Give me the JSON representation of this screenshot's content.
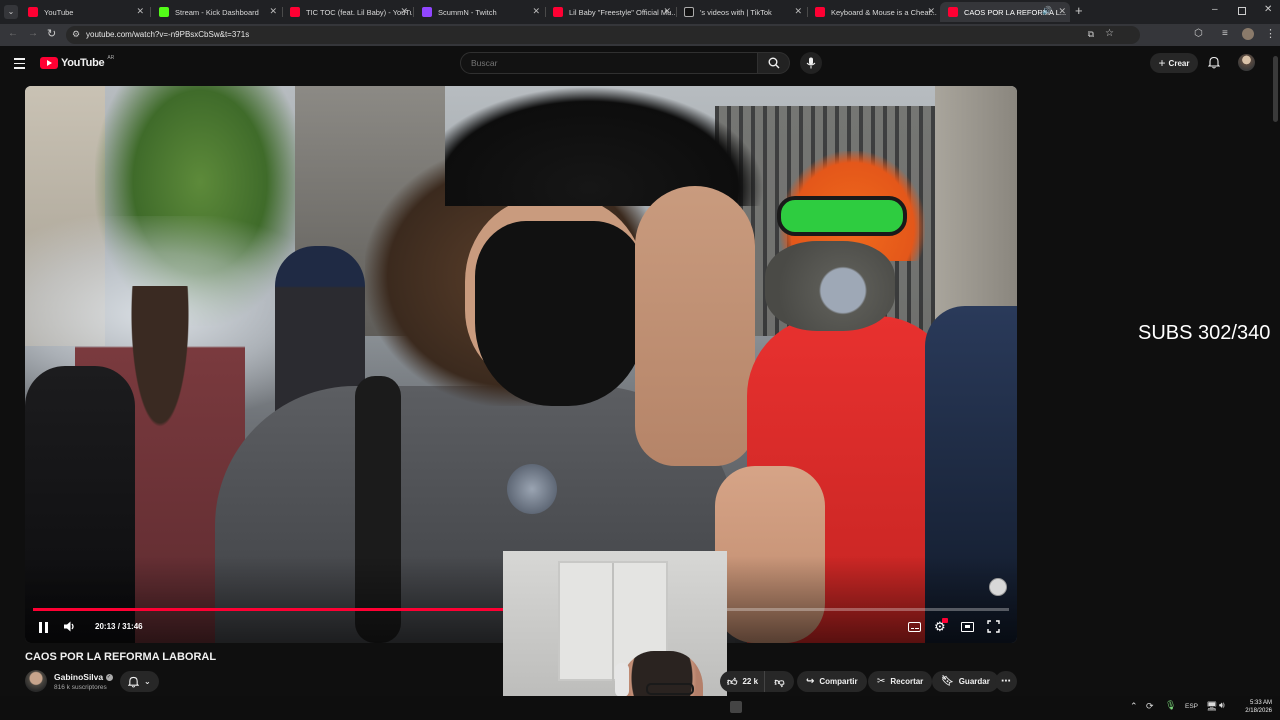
{
  "browser": {
    "tabs": [
      {
        "label": "YouTube",
        "color": "#ff0033"
      },
      {
        "label": "Stream - Kick Dashboard",
        "color": "#53fc18"
      },
      {
        "label": "TIC TOC (feat. Lil Baby) - YouTu...",
        "color": "#ff0033"
      },
      {
        "label": "ScummN - Twitch",
        "color": "#9146ff"
      },
      {
        "label": "Lil Baby \"Freestyle\" Official Mu...",
        "color": "#ff0033"
      },
      {
        "label": "'s videos with | TikTok",
        "color": "#ffffff"
      },
      {
        "label": "Keyboard & Mouse is a Cheat...",
        "color": "#ff0033"
      },
      {
        "label": "CAOS POR LA REFORMA L...",
        "color": "#ff0033"
      }
    ],
    "url": "youtube.com/watch?v=-n9PBsxCbSw&t=371s"
  },
  "youtube": {
    "logo": "YouTube",
    "region": "AR",
    "search_placeholder": "Buscar",
    "create_label": "Crear"
  },
  "player": {
    "time_current": "20:13",
    "time_total": "31:46",
    "progress": 0.637,
    "overlay_text": "SUBS 302/340"
  },
  "video": {
    "title": "CAOS POR LA REFORMA LABORAL",
    "channel": "GabinoSilva",
    "subscribers": "816 k suscriptores",
    "likes": "22 k",
    "share_label": "Compartir",
    "clip_label": "Recortar",
    "save_label": "Guardar"
  },
  "taskbar": {
    "language": "ESP",
    "time": "5:33 AM",
    "date": "2/18/2026"
  },
  "colors": {
    "accent_red": "#ff0033",
    "background": "#0f0f0f",
    "pill": "#272727"
  }
}
